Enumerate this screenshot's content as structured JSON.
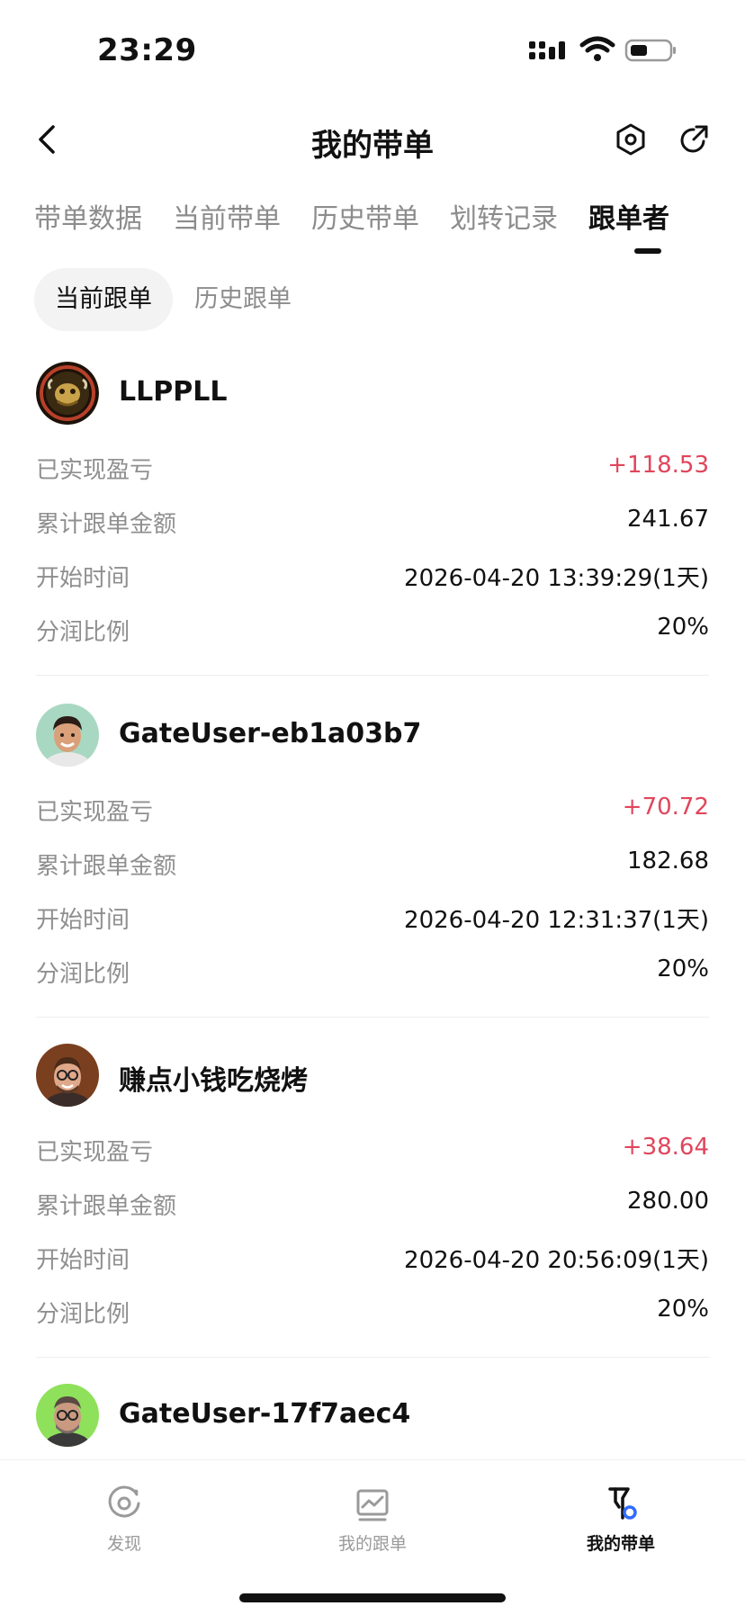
{
  "status_bar": {
    "time": "23:29"
  },
  "header": {
    "title": "我的带单"
  },
  "tabs": [
    {
      "label": "带单数据"
    },
    {
      "label": "当前带单"
    },
    {
      "label": "历史带单"
    },
    {
      "label": "划转记录"
    },
    {
      "label": "跟单者"
    }
  ],
  "subtabs": [
    {
      "label": "当前跟单"
    },
    {
      "label": "历史跟单"
    }
  ],
  "labels": {
    "pnl": "已实现盈亏",
    "amount": "累计跟单金额",
    "start": "开始时间",
    "share": "分润比例"
  },
  "followers": [
    {
      "name": "LLPPLL",
      "pnl": "+118.53",
      "amount": "241.67",
      "start": "2026-04-20 13:39:29(1天)",
      "share": "20%"
    },
    {
      "name": "GateUser-eb1a03b7",
      "pnl": "+70.72",
      "amount": "182.68",
      "start": "2026-04-20 12:31:37(1天)",
      "share": "20%"
    },
    {
      "name": "赚点小钱吃烧烤",
      "pnl": "+38.64",
      "amount": "280.00",
      "start": "2026-04-20 20:56:09(1天)",
      "share": "20%"
    },
    {
      "name": "GateUser-17f7aec4"
    }
  ],
  "bottom_nav": [
    {
      "label": "发现",
      "icon": "discover-icon"
    },
    {
      "label": "我的跟单",
      "icon": "chart-icon"
    },
    {
      "label": "我的带单",
      "icon": "lead-trade-icon"
    }
  ],
  "colors": {
    "profit": "#e0465c",
    "active_nav_badge": "#2f6bff"
  }
}
